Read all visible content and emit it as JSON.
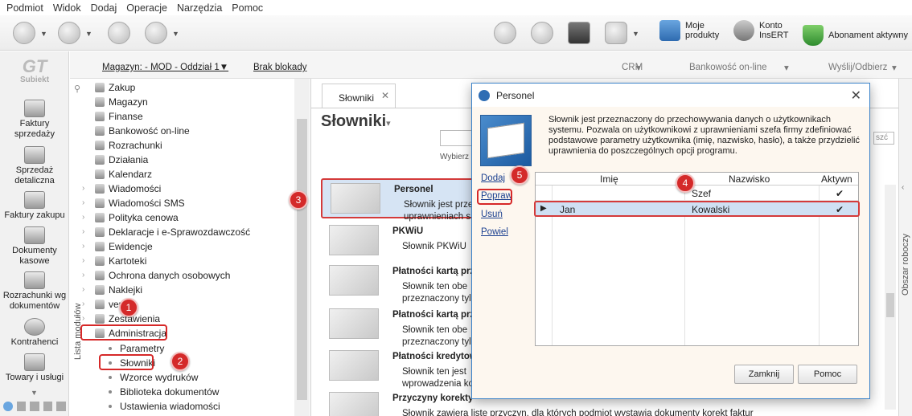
{
  "menu": [
    "Podmiot",
    "Widok",
    "Dodaj",
    "Operacje",
    "Narzędzia",
    "Pomoc"
  ],
  "toolbar_right": {
    "moje_produkty": [
      "Moje",
      "produkty"
    ],
    "konto": [
      "Konto",
      "InsERT"
    ],
    "abonament": "Abonament aktywny"
  },
  "leftbar": {
    "logo_big": "GT",
    "logo_small": "Subiekt",
    "items": [
      "Faktury sprzedaży",
      "Sprzedaż detaliczna",
      "Faktury zakupu",
      "Dokumenty kasowe",
      "Rozrachunki wg dokumentów",
      "Kontrahenci",
      "Towary i usługi"
    ]
  },
  "modbar": {
    "magazyn": "Magazyn: - MOD - Oddział 1▼",
    "blokady": "Brak blokady",
    "crm": "CRM",
    "bank": "Bankowość on-line",
    "wyslij": "Wyślij/Odbierz"
  },
  "modules": {
    "label": "Lista modułów",
    "items": [
      "Zakup",
      "Magazyn",
      "Finanse",
      "Bankowość on-line",
      "Rozrachunki",
      "Działania",
      "Kalendarz",
      "Wiadomości",
      "Wiadomości SMS",
      "Polityka cenowa",
      "Deklaracje i e-Sprawozdawczość",
      "Ewidencje",
      "Kartoteki",
      "Ochrona danych osobowych",
      "Naklejki",
      "vendo",
      "Zestawienia",
      "Administracja"
    ],
    "sub": [
      "Parametry",
      "Słowniki",
      "Wzorce wydruków",
      "Biblioteka dokumentów",
      "Ustawienia wiadomości"
    ]
  },
  "content": {
    "tab": "Słowniki",
    "title": "Słowniki",
    "wybierz": "Wybierz",
    "rows": [
      {
        "t": "Personel",
        "d": [
          "Słownik jest prze",
          "uprawnieniach s"
        ]
      },
      {
        "t": "PKWiU",
        "d": [
          "Słownik PKWiU"
        ]
      },
      {
        "t": "Płatności kartą przy",
        "d": [
          "Słownik ten obe",
          "przeznaczony tyl"
        ]
      },
      {
        "t": "Płatności kartą przy",
        "d": [
          "Słownik ten obe",
          "przeznaczony tyl"
        ]
      },
      {
        "t": "Płatności kredytow",
        "d": [
          "Słownik ten jest",
          "wprowadzenia ko"
        ]
      },
      {
        "t": "Przyczyny korekty",
        "d": [
          "Słownik zawiera listę przyczyn, dla których podmiot wystawia dokumenty korekt faktur sprzedaży i zakupu."
        ]
      }
    ],
    "search_btn": "szć"
  },
  "rrail": "Obszar roboczy",
  "dialog": {
    "title": "Personel",
    "desc": "Słownik jest przeznaczony do przechowywania danych o użytkownikach systemu. Pozwala on użytkownikowi z uprawnieniami szefa firmy zdefiniować podstawowe parametry użytkownika (imię, nazwisko, hasło), a także przydzielić uprawnienia do poszczególnych opcji programu.",
    "links": [
      "Dodaj",
      "Popraw",
      "Usuń",
      "Powiel"
    ],
    "headers": [
      "Imię",
      "Nazwisko",
      "Aktywn"
    ],
    "rows": [
      {
        "imie": "",
        "nazwisko": "Szef",
        "aktywny": "✔"
      },
      {
        "imie": "Jan",
        "nazwisko": "Kowalski",
        "aktywny": "✔"
      }
    ],
    "ok": "Zamknij",
    "help": "Pomoc"
  },
  "badges": [
    "1",
    "2",
    "3",
    "4",
    "5"
  ],
  "colors": {
    "accent": "#d42a2a",
    "selection": "#cfe0f3",
    "dialog_border": "#3c83c9"
  }
}
